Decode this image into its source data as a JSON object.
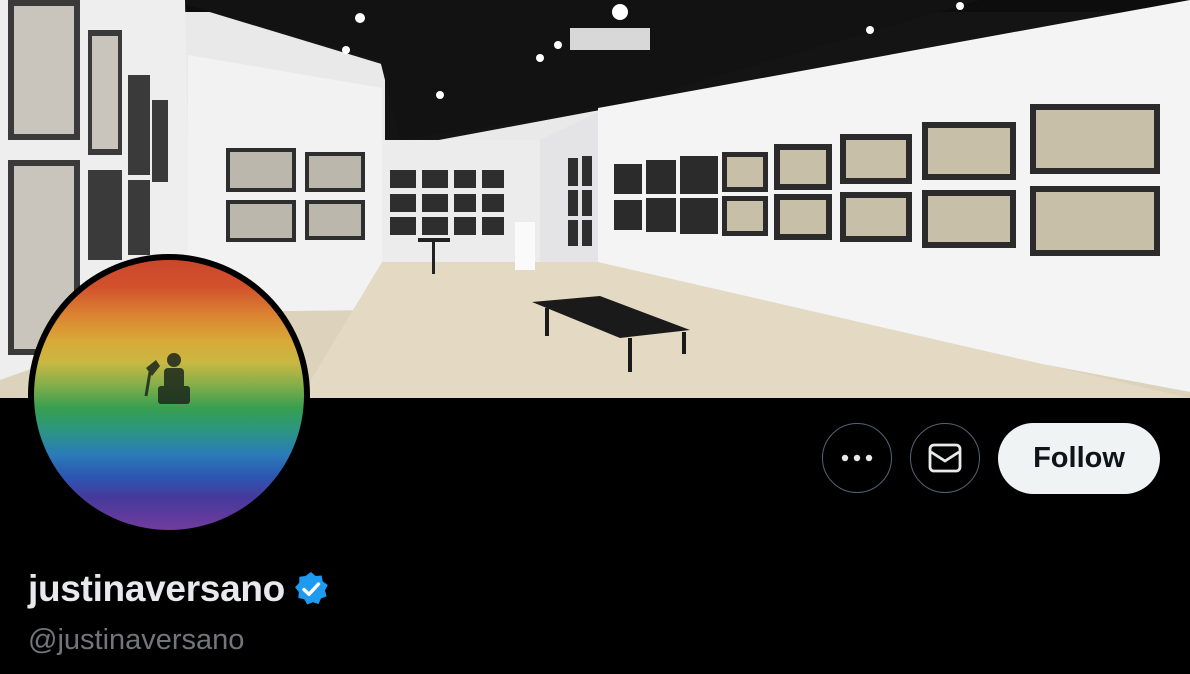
{
  "profile": {
    "display_name": "justinaversano",
    "handle": "@justinaversano",
    "verified_badge": "verified-badge-icon",
    "accent_color": "#1d9bf0"
  },
  "actions": {
    "more_icon": "more-icon",
    "message_icon": "message-icon",
    "follow_label": "Follow"
  },
  "colors": {
    "background": "#000000",
    "follow_button_bg": "#eff3f4",
    "handle_color": "#71767b"
  }
}
